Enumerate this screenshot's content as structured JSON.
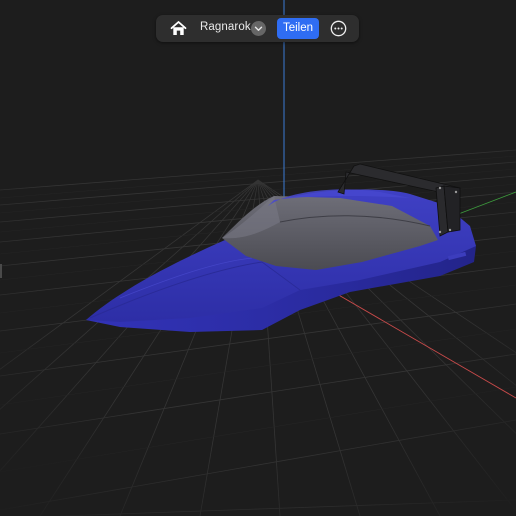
{
  "toolbar": {
    "home_icon": "house-icon",
    "title": "Ragnarok",
    "title_menu_icon": "chevron-down-icon",
    "share_label": "Teilen",
    "more_icon": "ellipsis-circle-icon"
  },
  "scene": {
    "model": "boat-model",
    "axes": {
      "x_color": "#c84a4a",
      "y_color": "#3d9a3d",
      "z_color": "#3a7bd5"
    },
    "hull_color": "#3334b8",
    "canopy_color": "#5c5c66",
    "background_color": "#1d1d1d"
  }
}
